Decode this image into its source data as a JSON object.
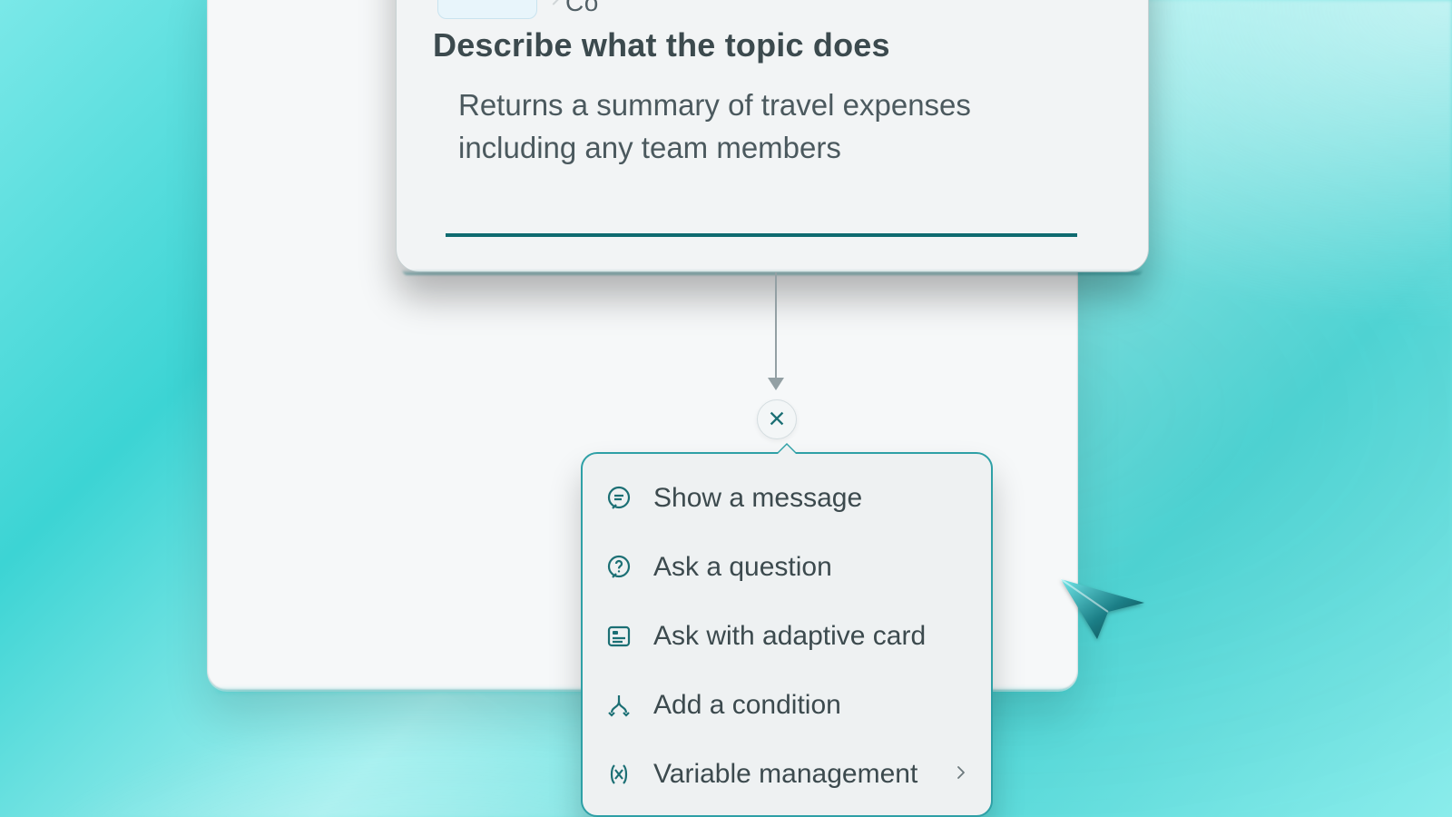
{
  "colors": {
    "accent": "#1b6f74",
    "menu_border": "#2ea0a6",
    "text": "#3c4a4e",
    "muted": "#526066"
  },
  "trigger": {
    "partial_label": "Co",
    "section_title": "Describe what the topic does",
    "description_value": "Returns a summary of travel expenses including any team members"
  },
  "menu": {
    "items": [
      {
        "icon": "chat-bubble-icon",
        "label": "Show a message",
        "has_submenu": false
      },
      {
        "icon": "question-icon",
        "label": "Ask a question",
        "has_submenu": false
      },
      {
        "icon": "adaptive-card-icon",
        "label": "Ask with adaptive card",
        "has_submenu": false
      },
      {
        "icon": "branch-icon",
        "label": "Add a condition",
        "has_submenu": false
      },
      {
        "icon": "variable-icon",
        "label": "Variable management",
        "has_submenu": true
      }
    ]
  }
}
